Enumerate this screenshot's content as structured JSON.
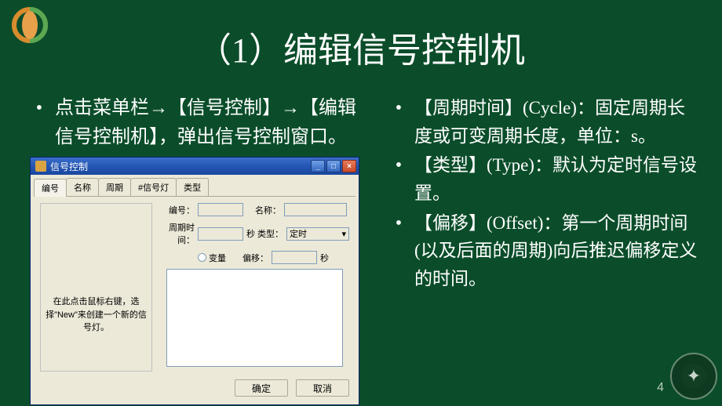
{
  "title": "（1）编辑信号控制机",
  "bullet_main": "点击菜单栏→【信号控制】→【编辑信号控制机】，弹出信号控制窗口。",
  "right_bullets": [
    "【周期时间】(Cycle)：固定周期长度或可变周期长度，单位：s。",
    "【类型】(Type)：默认为定时信号设置。",
    "【偏移】(Offset)：第一个周期时间(以及后面的周期)向后推迟偏移定义的时间。"
  ],
  "page_number": "4",
  "dialog": {
    "title": "信号控制",
    "tabs": [
      "编号",
      "名称",
      "周期",
      "#信号灯",
      "类型"
    ],
    "hint": "在此点击鼠标右键，选择\"New\"来创建一个新的信号灯。",
    "fields": {
      "id_label": "编号：",
      "name_label": "名称：",
      "cycle_label": "周期时间：",
      "cycle_unit": "秒",
      "type_label": "类型：",
      "type_value": "定时",
      "var_label": "变量",
      "offset_label": "偏移：",
      "offset_unit": "秒"
    },
    "buttons": {
      "ok": "确定",
      "cancel": "取消"
    }
  }
}
